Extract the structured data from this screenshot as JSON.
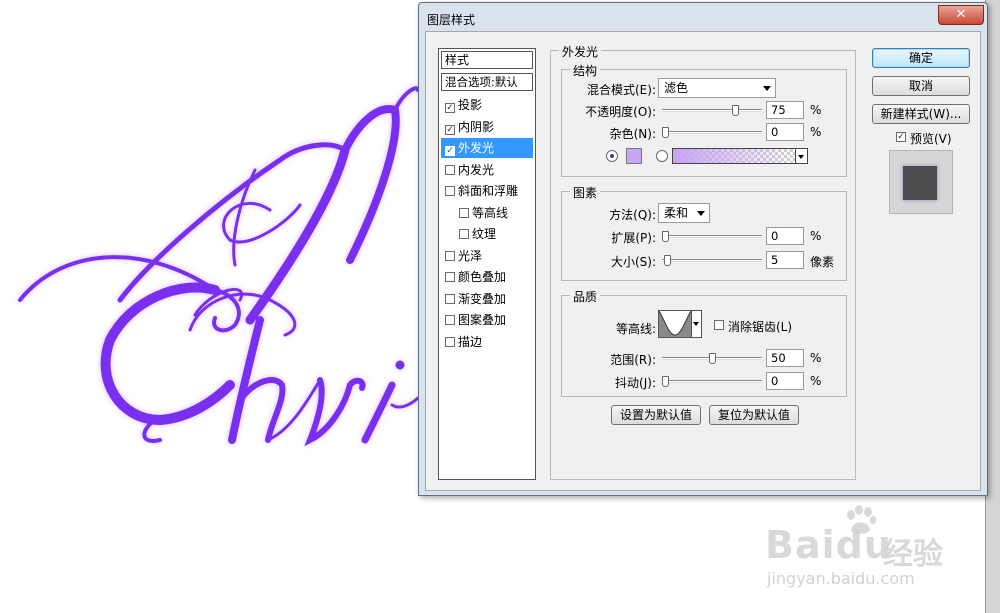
{
  "dialog": {
    "title": "图层样式",
    "close_glyph": "✕"
  },
  "styles_panel": {
    "header": "样式",
    "blend_options": "混合选项:默认",
    "items": [
      {
        "label": "投影",
        "checked": true,
        "selected": false,
        "indent": false
      },
      {
        "label": "内阴影",
        "checked": true,
        "selected": false,
        "indent": false
      },
      {
        "label": "外发光",
        "checked": true,
        "selected": true,
        "indent": false
      },
      {
        "label": "内发光",
        "checked": false,
        "selected": false,
        "indent": false
      },
      {
        "label": "斜面和浮雕",
        "checked": false,
        "selected": false,
        "indent": false
      },
      {
        "label": "等高线",
        "checked": false,
        "selected": false,
        "indent": true
      },
      {
        "label": "纹理",
        "checked": false,
        "selected": false,
        "indent": true
      },
      {
        "label": "光泽",
        "checked": false,
        "selected": false,
        "indent": false
      },
      {
        "label": "颜色叠加",
        "checked": false,
        "selected": false,
        "indent": false
      },
      {
        "label": "渐变叠加",
        "checked": false,
        "selected": false,
        "indent": false
      },
      {
        "label": "图案叠加",
        "checked": false,
        "selected": false,
        "indent": false
      },
      {
        "label": "描边",
        "checked": false,
        "selected": false,
        "indent": false
      }
    ]
  },
  "outer_glow": {
    "title": "外发光",
    "structure": {
      "title": "结构",
      "blend_mode_label": "混合模式(E):",
      "blend_mode_value": "滤色",
      "opacity_label": "不透明度(O):",
      "opacity_value": "75",
      "opacity_percent": 0.75,
      "noise_label": "杂色(N):",
      "noise_value": "0",
      "noise_percent": 0.0,
      "percent_sign": "%",
      "glow_color": "#c7a4f4"
    },
    "elements": {
      "title": "图素",
      "technique_label": "方法(Q):",
      "technique_value": "柔和",
      "spread_label": "扩展(P):",
      "spread_value": "0",
      "spread_percent": 0.0,
      "size_label": "大小(S):",
      "size_value": "5",
      "size_fraction": 0.02,
      "size_unit": "像素",
      "percent_sign": "%"
    },
    "quality": {
      "title": "品质",
      "contour_label": "等高线:",
      "antialias_label": "消除锯齿(L)",
      "antialias_checked": false,
      "range_label": "范围(R):",
      "range_value": "50",
      "range_percent": 0.5,
      "jitter_label": "抖动(J):",
      "jitter_value": "0",
      "jitter_percent": 0.0,
      "percent_sign": "%"
    },
    "make_default": "设置为默认值",
    "reset_default": "复位为默认值"
  },
  "buttons": {
    "ok": "确定",
    "cancel": "取消",
    "new_style": "新建样式(W)...",
    "preview_label": "预览(V)",
    "preview_checked": true
  },
  "canvas": {
    "text_color": "#7a2ff0"
  },
  "watermark": {
    "logo": "Baidu",
    "logo_cn": "经验",
    "url": "jingyan.baidu.com"
  }
}
